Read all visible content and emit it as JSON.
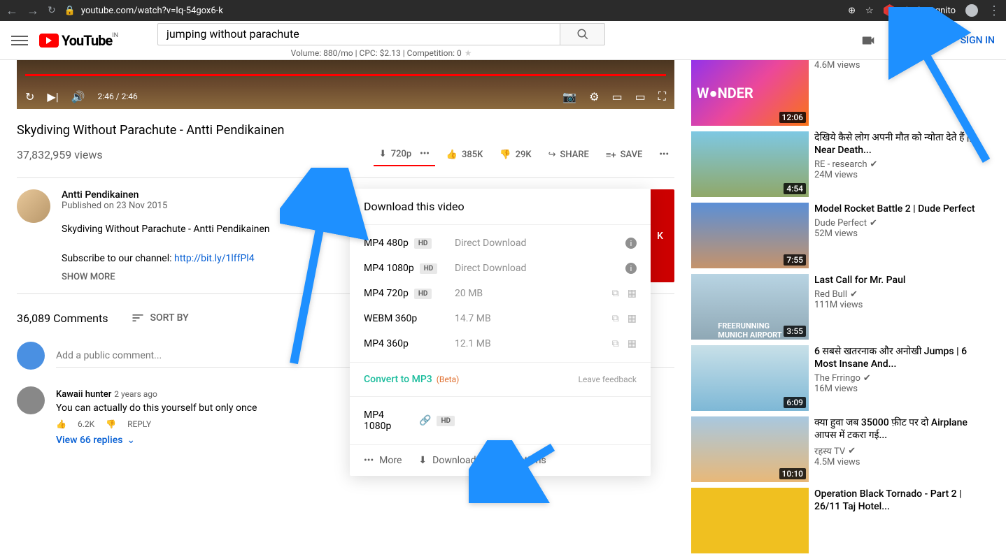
{
  "browser": {
    "url": "youtube.com/watch?v=Iq-54gox6-k",
    "incognito": "Incognito"
  },
  "header": {
    "logo_text": "YouTube",
    "country": "IN",
    "search_value": "jumping without parachute",
    "search_meta": "Volume: 880/mo | CPC: $2.13 | Competition: 0",
    "signin": "SIGN IN"
  },
  "player": {
    "time": "2:46 / 2:46"
  },
  "video": {
    "title": "Skydiving Without Parachute - Antti Pendikainen",
    "views": "37,832,959 views",
    "download_quality": "720p",
    "likes": "385K",
    "dislikes": "29K",
    "share": "SHARE",
    "save": "SAVE"
  },
  "channel": {
    "name": "Antti Pendikainen",
    "published": "Published on 23 Nov 2015",
    "desc_line1": "Skydiving Without Parachute - Antti Pendikainen",
    "desc_line2": "Subscribe to our channel: ",
    "desc_link": "http://bit.ly/1lffPl4",
    "show_more": "SHOW MORE",
    "subscribe": "K"
  },
  "comments": {
    "count": "36,089 Comments",
    "sort": "SORT BY",
    "placeholder": "Add a public comment...",
    "c1_author": "Kawaii hunter",
    "c1_date": "2 years ago",
    "c1_text": "You can actually do this yourself but only once",
    "c1_likes": "6.2K",
    "c1_reply": "REPLY",
    "c1_replies": "View 66 replies"
  },
  "popup": {
    "title": "Download this video",
    "rows": [
      {
        "format": "MP4 480p",
        "hd": true,
        "size": "Direct Download",
        "info": true
      },
      {
        "format": "MP4 1080p",
        "hd": true,
        "size": "Direct Download",
        "info": true
      },
      {
        "format": "MP4 720p",
        "hd": true,
        "size": "20 MB",
        "copy": true
      },
      {
        "format": "WEBM 360p",
        "hd": false,
        "size": "14.7 MB",
        "copy": true
      },
      {
        "format": "MP4 360p",
        "hd": false,
        "size": "12.1 MB",
        "copy": true
      }
    ],
    "mp3": "Convert to MP3",
    "beta": "(Beta)",
    "feedback": "Leave feedback",
    "bonus_format": "MP4 1080p",
    "more": "More",
    "downloads": "Downloads",
    "options": "Options"
  },
  "recs": [
    {
      "title": "",
      "channel": "",
      "views": "4.6M views",
      "dur": "12:06",
      "thumb": "wonder"
    },
    {
      "title": "देखिये कैसे लोग अपनी मौत को न्योता देते हैं || Near Death...",
      "channel": "RE - research",
      "views": "24M views",
      "dur": "4:54",
      "thumb": "cliff"
    },
    {
      "title": "Model Rocket Battle 2 | Dude Perfect",
      "channel": "Dude Perfect",
      "views": "52M views",
      "dur": "7:55",
      "thumb": "rocket"
    },
    {
      "title": "Last Call for Mr. Paul",
      "channel": "Red Bull",
      "views": "111M views",
      "dur": "3:55",
      "thumb": "airport"
    },
    {
      "title": "6 सबसे खतरनाक और अनोखी Jumps | 6 Most Insane And...",
      "channel": "The Frringo",
      "views": "16M views",
      "dur": "6:09",
      "thumb": "jump"
    },
    {
      "title": "क्या हुवा जब 35000 फ़ीट पर दो Airplane आपस में टकरा गई...",
      "channel": "रहस्य TV",
      "views": "4.5M views",
      "dur": "10:10",
      "thumb": "plane"
    },
    {
      "title": "Operation Black Tornado - Part 2 | 26/11 Taj Hotel...",
      "channel": "",
      "views": "",
      "dur": "",
      "thumb": "yellow"
    }
  ]
}
